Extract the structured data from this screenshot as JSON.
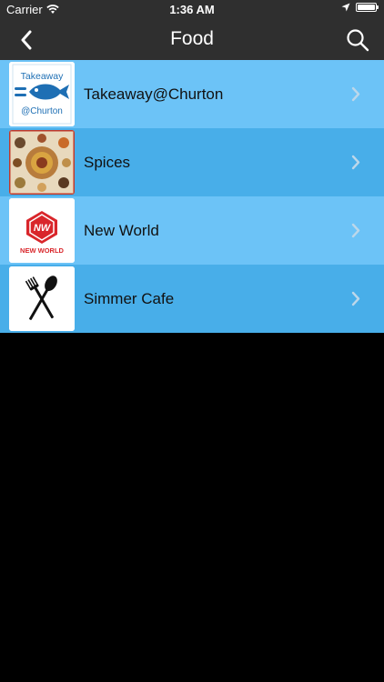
{
  "status_bar": {
    "carrier": "Carrier",
    "time": "1:36 AM"
  },
  "nav": {
    "title": "Food",
    "back_icon": "chevron-left-icon",
    "search_icon": "search-icon"
  },
  "list": {
    "items": [
      {
        "label": "Takeaway@Churton",
        "logo_text_top": "Takeaway",
        "logo_text_bottom": "@Churton"
      },
      {
        "label": "Spices"
      },
      {
        "label": "New World",
        "logo_text_top": "NW",
        "logo_text_bottom": "NEW WORLD"
      },
      {
        "label": "Simmer Cafe"
      }
    ]
  },
  "colors": {
    "bar_background": "#2f2f2f",
    "row_light": "#6cc3f7",
    "row_dark": "#48aee9",
    "brand_red": "#d9262b",
    "brand_blue": "#1e6fb4"
  }
}
